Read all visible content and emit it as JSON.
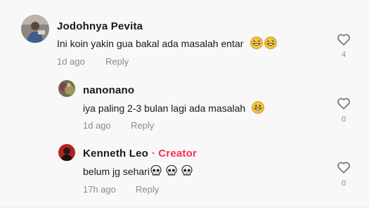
{
  "comments": [
    {
      "username": "Jodohnya Pevita",
      "text": "Ini koin yakin gua bakal ada masalah entar",
      "emojis": [
        "grinning-sweat-icon",
        "grinning-sweat-icon"
      ],
      "time": "1d ago",
      "reply_label": "Reply",
      "likes": "4"
    },
    {
      "username": "nanonano",
      "text": "iya paling 2-3 bulan lagi ada masalah",
      "emojis": [
        "grinning-icon"
      ],
      "time": "1d ago",
      "reply_label": "Reply",
      "likes": "0"
    },
    {
      "username": "Kenneth Leo",
      "badge_separator": "·",
      "badge": "Creator",
      "text": "belum jg sehari",
      "emojis": [
        "skull-icon",
        "skull-icon",
        "skull-icon"
      ],
      "time": "17h ago",
      "reply_label": "Reply",
      "likes": "0"
    }
  ],
  "colors": {
    "background": "#f8f8f8",
    "text": "#161823",
    "muted": "#8a8b91",
    "creator": "#fe2c55"
  }
}
